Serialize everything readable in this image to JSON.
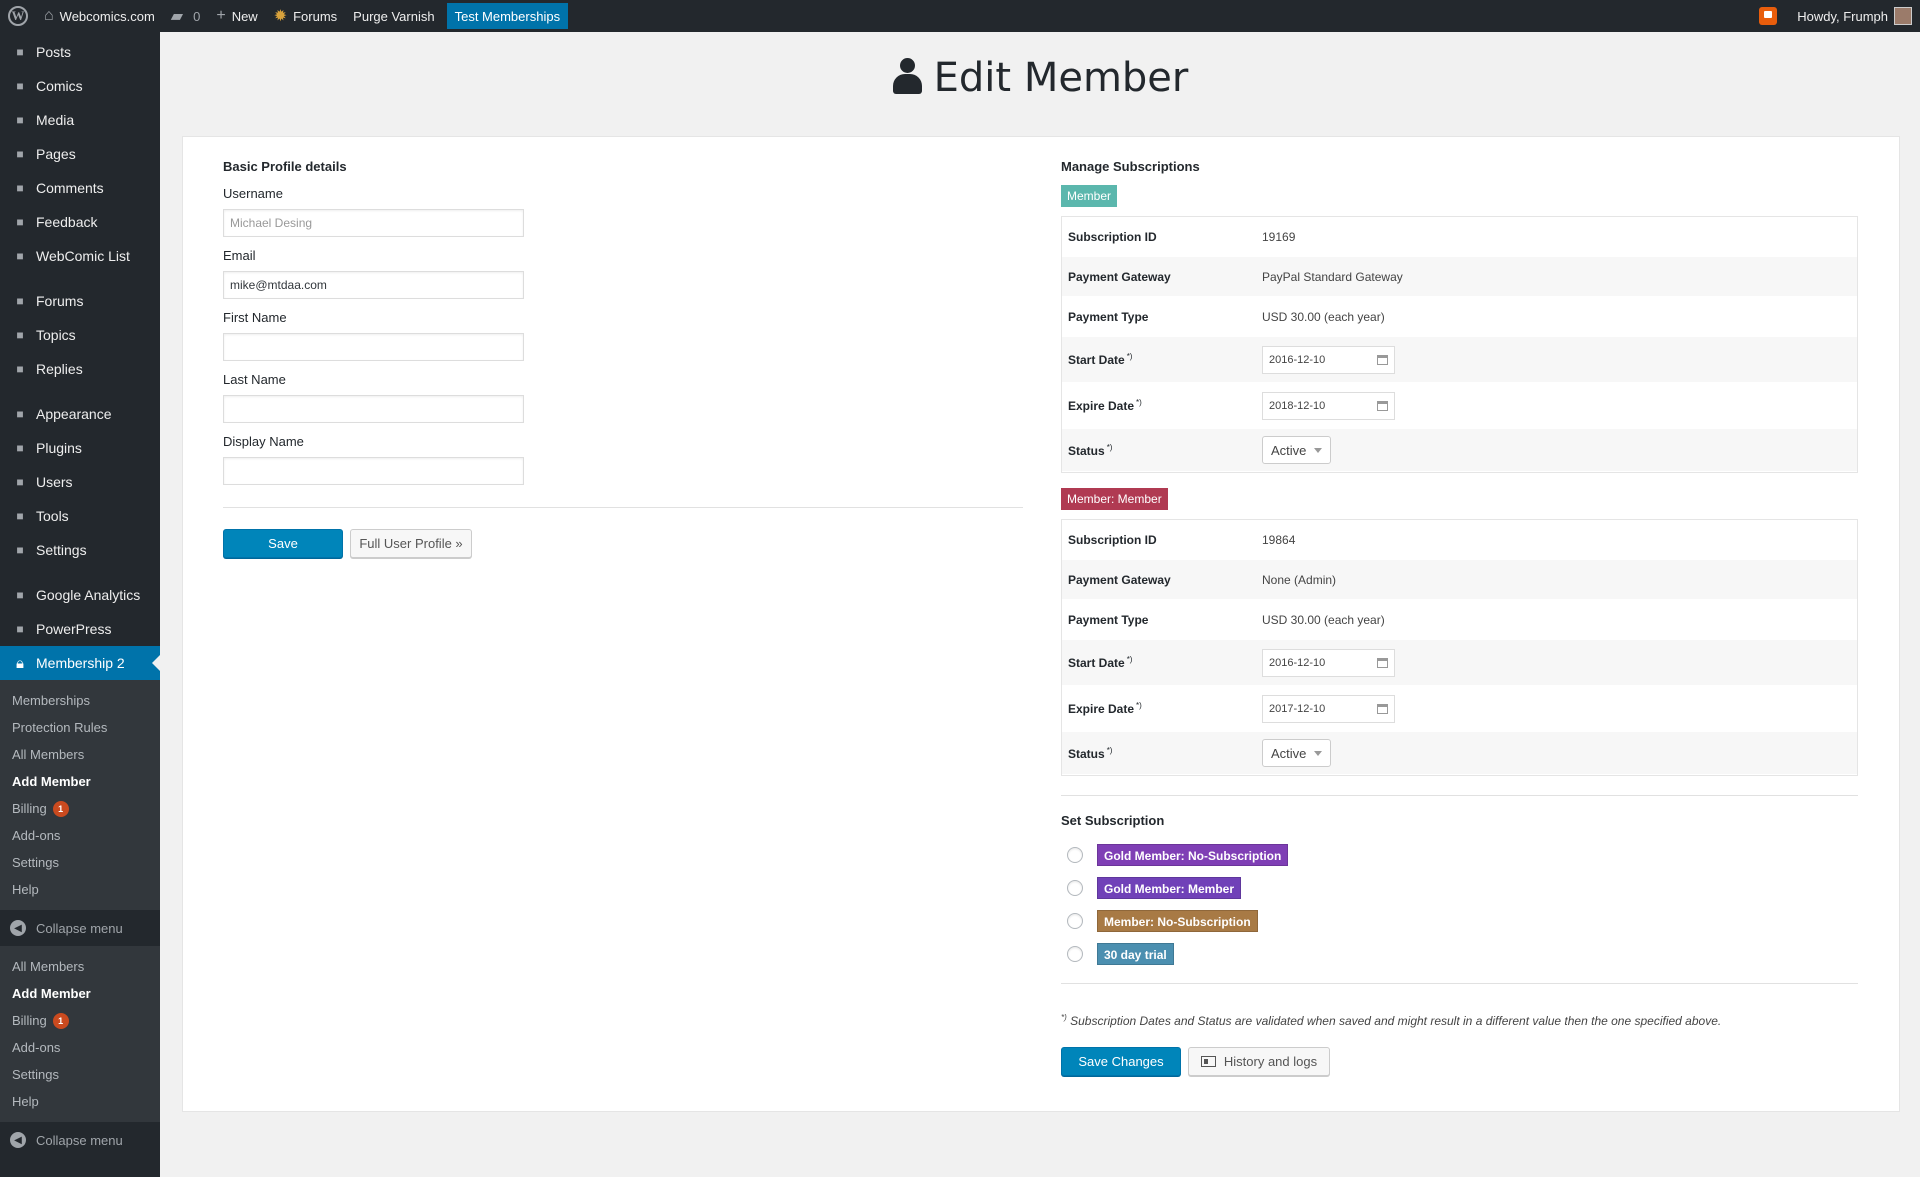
{
  "adminbar": {
    "site": "Webcomics.com",
    "comments_count": "0",
    "new_label": "New",
    "forums_label": "Forums",
    "purge_label": "Purge Varnish",
    "test_label": "Test Memberships",
    "howdy": "Howdy, Frumph"
  },
  "sidebar": {
    "group1": [
      {
        "label": "Posts",
        "icon": "pin-icon"
      },
      {
        "label": "Comics",
        "icon": "shield-icon"
      },
      {
        "label": "Media",
        "icon": "media-icon"
      },
      {
        "label": "Pages",
        "icon": "pages-icon"
      },
      {
        "label": "Comments",
        "icon": "comment-icon"
      },
      {
        "label": "Feedback",
        "icon": "feedback-icon"
      },
      {
        "label": "WebComic List",
        "icon": "pin-icon"
      }
    ],
    "group2": [
      {
        "label": "Forums",
        "icon": "forums-icon"
      },
      {
        "label": "Topics",
        "icon": "topics-icon"
      },
      {
        "label": "Replies",
        "icon": "replies-icon"
      }
    ],
    "group3": [
      {
        "label": "Appearance",
        "icon": "brush-icon"
      },
      {
        "label": "Plugins",
        "icon": "plug-icon"
      },
      {
        "label": "Users",
        "icon": "user-icon"
      },
      {
        "label": "Tools",
        "icon": "wrench-icon"
      },
      {
        "label": "Settings",
        "icon": "settings-icon"
      }
    ],
    "group4": [
      {
        "label": "Google Analytics",
        "icon": "chart-icon"
      },
      {
        "label": "PowerPress",
        "icon": "powerpress-icon"
      }
    ],
    "current": {
      "label": "Membership 2",
      "icon": "lock-icon"
    },
    "submenu1": [
      "Memberships",
      "Protection Rules",
      "All Members",
      "Add Member",
      "Billing",
      "Add-ons",
      "Settings",
      "Help"
    ],
    "billing_badge": "1",
    "collapse_label": "Collapse menu",
    "submenu2": [
      "All Members",
      "Add Member",
      "Billing",
      "Add-ons",
      "Settings",
      "Help"
    ]
  },
  "page": {
    "title": "Edit Member"
  },
  "profile": {
    "section_title": "Basic Profile details",
    "username_label": "Username",
    "username_value": "Michael Desing",
    "email_label": "Email",
    "email_value": "mike@mtdaa.com",
    "first_name_label": "First Name",
    "first_name_value": "",
    "last_name_label": "Last Name",
    "last_name_value": "",
    "display_name_label": "Display Name",
    "display_name_value": "",
    "save_label": "Save",
    "full_profile_label": "Full User Profile »"
  },
  "subscriptions": {
    "section_title": "Manage Subscriptions",
    "items": [
      {
        "tag": "Member",
        "tag_color": "#5bb7ad",
        "rows": {
          "id_label": "Subscription ID",
          "id": "19169",
          "gateway_label": "Payment Gateway",
          "gateway": "PayPal Standard Gateway",
          "type_label": "Payment Type",
          "type": "USD 30.00 (each year)",
          "start_label": "Start Date",
          "start": "2016-12-10",
          "expire_label": "Expire Date",
          "expire": "2018-12-10",
          "status_label": "Status",
          "status": "Active"
        }
      },
      {
        "tag": "Member: Member",
        "tag_color": "#b03a52",
        "rows": {
          "id_label": "Subscription ID",
          "id": "19864",
          "gateway_label": "Payment Gateway",
          "gateway": "None (Admin)",
          "type_label": "Payment Type",
          "type": "USD 30.00 (each year)",
          "start_label": "Start Date",
          "start": "2016-12-10",
          "expire_label": "Expire Date",
          "expire": "2017-12-10",
          "status_label": "Status",
          "status": "Active"
        }
      }
    ],
    "asterisk": "*)"
  },
  "set_subscription": {
    "title": "Set Subscription",
    "options": [
      {
        "label": "Gold Member: No-Subscription",
        "color": "#7f3fb5"
      },
      {
        "label": "Gold Member: Member",
        "color": "#7041b8"
      },
      {
        "label": "Member: No-Subscription",
        "color": "#a87a45"
      },
      {
        "label": "30 day trial",
        "color": "#4b8fb0"
      }
    ]
  },
  "footer": {
    "note_mark": "*)",
    "note": "Subscription Dates and Status are validated when saved and might result in a different value then the one specified above.",
    "save_changes": "Save Changes",
    "history_label": "History and logs"
  }
}
